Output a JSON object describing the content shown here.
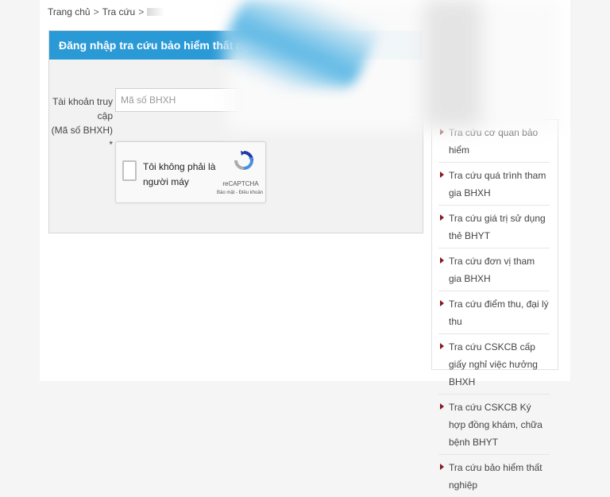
{
  "breadcrumb": {
    "home": "Trang chủ",
    "sep": ">",
    "lookup": "Tra cứu",
    "sep2": ">"
  },
  "login": {
    "title": "Đăng nhập tra cứu bảo hiểm thất nghiệp",
    "account_label_line1": "Tài khoản truy cập",
    "account_label_line2": "(Mã số BHXH) *",
    "account_placeholder": "Mã số BHXH",
    "account_value": ""
  },
  "recaptcha": {
    "label": "Tôi không phải là người máy",
    "brand": "reCAPTCHA",
    "links": "Bảo mật - Điều khoản"
  },
  "sidebar": {
    "items": [
      {
        "label": "Tra cứu cơ quan bảo hiểm"
      },
      {
        "label": "Tra cứu quá trình tham gia BHXH"
      },
      {
        "label": "Tra cứu giá trị sử dụng thẻ BHYT"
      },
      {
        "label": "Tra cứu đơn vị tham gia BHXH"
      },
      {
        "label": "Tra cứu điểm thu, đại lý thu"
      },
      {
        "label": "Tra cứu CSKCB cấp giấy nghỉ việc hưởng BHXH"
      },
      {
        "label": "Tra cứu CSKCB Ký hợp đồng khám, chữa bệnh BHYT"
      },
      {
        "label": "Tra cứu bảo hiểm thất nghiệp"
      }
    ]
  },
  "colors": {
    "header_blue": "#2a9ad6",
    "arrow_red": "#8b1a1a",
    "recaptcha_blue": "#4a90e2"
  },
  "icons": {
    "list_bullet": "arrow-icon",
    "captcha": "recaptcha-logo-icon"
  }
}
